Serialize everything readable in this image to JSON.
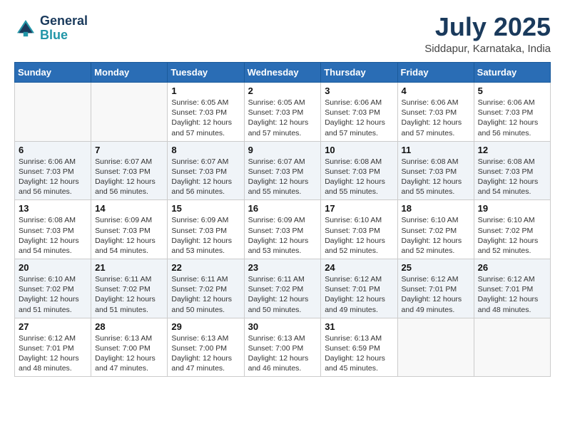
{
  "header": {
    "logo_line1": "General",
    "logo_line2": "Blue",
    "month_year": "July 2025",
    "location": "Siddapur, Karnataka, India"
  },
  "days_of_week": [
    "Sunday",
    "Monday",
    "Tuesday",
    "Wednesday",
    "Thursday",
    "Friday",
    "Saturday"
  ],
  "weeks": [
    [
      {
        "day": "",
        "info": ""
      },
      {
        "day": "",
        "info": ""
      },
      {
        "day": "1",
        "info": "Sunrise: 6:05 AM\nSunset: 7:03 PM\nDaylight: 12 hours and 57 minutes."
      },
      {
        "day": "2",
        "info": "Sunrise: 6:05 AM\nSunset: 7:03 PM\nDaylight: 12 hours and 57 minutes."
      },
      {
        "day": "3",
        "info": "Sunrise: 6:06 AM\nSunset: 7:03 PM\nDaylight: 12 hours and 57 minutes."
      },
      {
        "day": "4",
        "info": "Sunrise: 6:06 AM\nSunset: 7:03 PM\nDaylight: 12 hours and 57 minutes."
      },
      {
        "day": "5",
        "info": "Sunrise: 6:06 AM\nSunset: 7:03 PM\nDaylight: 12 hours and 56 minutes."
      }
    ],
    [
      {
        "day": "6",
        "info": "Sunrise: 6:06 AM\nSunset: 7:03 PM\nDaylight: 12 hours and 56 minutes."
      },
      {
        "day": "7",
        "info": "Sunrise: 6:07 AM\nSunset: 7:03 PM\nDaylight: 12 hours and 56 minutes."
      },
      {
        "day": "8",
        "info": "Sunrise: 6:07 AM\nSunset: 7:03 PM\nDaylight: 12 hours and 56 minutes."
      },
      {
        "day": "9",
        "info": "Sunrise: 6:07 AM\nSunset: 7:03 PM\nDaylight: 12 hours and 55 minutes."
      },
      {
        "day": "10",
        "info": "Sunrise: 6:08 AM\nSunset: 7:03 PM\nDaylight: 12 hours and 55 minutes."
      },
      {
        "day": "11",
        "info": "Sunrise: 6:08 AM\nSunset: 7:03 PM\nDaylight: 12 hours and 55 minutes."
      },
      {
        "day": "12",
        "info": "Sunrise: 6:08 AM\nSunset: 7:03 PM\nDaylight: 12 hours and 54 minutes."
      }
    ],
    [
      {
        "day": "13",
        "info": "Sunrise: 6:08 AM\nSunset: 7:03 PM\nDaylight: 12 hours and 54 minutes."
      },
      {
        "day": "14",
        "info": "Sunrise: 6:09 AM\nSunset: 7:03 PM\nDaylight: 12 hours and 54 minutes."
      },
      {
        "day": "15",
        "info": "Sunrise: 6:09 AM\nSunset: 7:03 PM\nDaylight: 12 hours and 53 minutes."
      },
      {
        "day": "16",
        "info": "Sunrise: 6:09 AM\nSunset: 7:03 PM\nDaylight: 12 hours and 53 minutes."
      },
      {
        "day": "17",
        "info": "Sunrise: 6:10 AM\nSunset: 7:03 PM\nDaylight: 12 hours and 52 minutes."
      },
      {
        "day": "18",
        "info": "Sunrise: 6:10 AM\nSunset: 7:02 PM\nDaylight: 12 hours and 52 minutes."
      },
      {
        "day": "19",
        "info": "Sunrise: 6:10 AM\nSunset: 7:02 PM\nDaylight: 12 hours and 52 minutes."
      }
    ],
    [
      {
        "day": "20",
        "info": "Sunrise: 6:10 AM\nSunset: 7:02 PM\nDaylight: 12 hours and 51 minutes."
      },
      {
        "day": "21",
        "info": "Sunrise: 6:11 AM\nSunset: 7:02 PM\nDaylight: 12 hours and 51 minutes."
      },
      {
        "day": "22",
        "info": "Sunrise: 6:11 AM\nSunset: 7:02 PM\nDaylight: 12 hours and 50 minutes."
      },
      {
        "day": "23",
        "info": "Sunrise: 6:11 AM\nSunset: 7:02 PM\nDaylight: 12 hours and 50 minutes."
      },
      {
        "day": "24",
        "info": "Sunrise: 6:12 AM\nSunset: 7:01 PM\nDaylight: 12 hours and 49 minutes."
      },
      {
        "day": "25",
        "info": "Sunrise: 6:12 AM\nSunset: 7:01 PM\nDaylight: 12 hours and 49 minutes."
      },
      {
        "day": "26",
        "info": "Sunrise: 6:12 AM\nSunset: 7:01 PM\nDaylight: 12 hours and 48 minutes."
      }
    ],
    [
      {
        "day": "27",
        "info": "Sunrise: 6:12 AM\nSunset: 7:01 PM\nDaylight: 12 hours and 48 minutes."
      },
      {
        "day": "28",
        "info": "Sunrise: 6:13 AM\nSunset: 7:00 PM\nDaylight: 12 hours and 47 minutes."
      },
      {
        "day": "29",
        "info": "Sunrise: 6:13 AM\nSunset: 7:00 PM\nDaylight: 12 hours and 47 minutes."
      },
      {
        "day": "30",
        "info": "Sunrise: 6:13 AM\nSunset: 7:00 PM\nDaylight: 12 hours and 46 minutes."
      },
      {
        "day": "31",
        "info": "Sunrise: 6:13 AM\nSunset: 6:59 PM\nDaylight: 12 hours and 45 minutes."
      },
      {
        "day": "",
        "info": ""
      },
      {
        "day": "",
        "info": ""
      }
    ]
  ]
}
